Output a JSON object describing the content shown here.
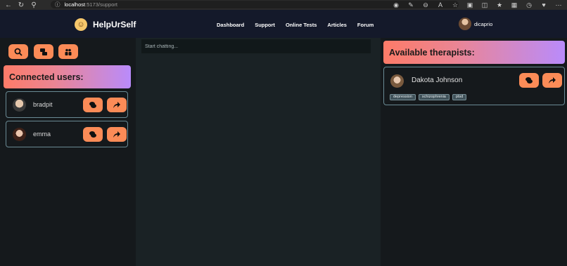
{
  "browser": {
    "url_host": "localhost",
    "url_path": ":5173/support",
    "back_icon": "arrow-left-icon",
    "reload_icon": "refresh-icon",
    "search_icon": "search-icon",
    "info_icon": "info-icon"
  },
  "navbar": {
    "brand": "HelpUrSelf",
    "links": [
      "Dashboard",
      "Support",
      "Online Tests",
      "Articles",
      "Forum"
    ],
    "profile_name": "dicaprio"
  },
  "left_panel": {
    "action_buttons": [
      "search-icon",
      "chat-bubbles-icon",
      "people-icon"
    ],
    "title": "Connected users:",
    "users": [
      {
        "name": "bradpit"
      },
      {
        "name": "emma"
      }
    ]
  },
  "chat": {
    "placeholder": "Start chatting..."
  },
  "right_panel": {
    "title": "Available therapists:",
    "therapists": [
      {
        "name": "Dakota Johnson",
        "tags": [
          "depression",
          "schizophrenia",
          "ptsd"
        ]
      }
    ]
  },
  "colors": {
    "accent": "#fb8b57",
    "navbar": "#14192a",
    "background": "#15191c",
    "gradient_start": "#fd7b68",
    "gradient_end": "#b98bfb"
  }
}
